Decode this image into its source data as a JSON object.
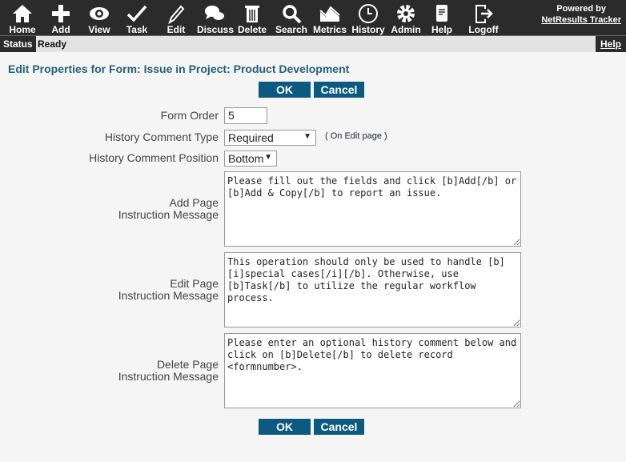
{
  "toolbar": {
    "items": [
      {
        "label": "Home",
        "icon": "home-icon"
      },
      {
        "label": "Add",
        "icon": "plus-icon"
      },
      {
        "label": "View",
        "icon": "eye-icon"
      },
      {
        "label": "Task",
        "icon": "check-icon"
      },
      {
        "label": "Edit",
        "icon": "pencil-icon"
      },
      {
        "label": "Discuss",
        "icon": "chat-icon"
      },
      {
        "label": "Delete",
        "icon": "trash-icon"
      },
      {
        "label": "Search",
        "icon": "search-icon"
      },
      {
        "label": "Metrics",
        "icon": "chart-icon"
      },
      {
        "label": "History",
        "icon": "clock-icon"
      },
      {
        "label": "Admin",
        "icon": "gear-icon"
      },
      {
        "label": "Help",
        "icon": "document-icon"
      },
      {
        "label": "Logoff",
        "icon": "logout-icon"
      }
    ],
    "powered_by": "Powered by",
    "brand_link": "NetResults Tracker"
  },
  "status": {
    "label": "Status",
    "value": "Ready",
    "help": "Help"
  },
  "page": {
    "title": "Edit Properties for Form: Issue in Project: Product Development",
    "ok": "OK",
    "cancel": "Cancel"
  },
  "form": {
    "form_order_label": "Form Order",
    "form_order": "5",
    "history_type_label": "History Comment Type",
    "history_type": "Required",
    "history_type_note": "( On Edit page )",
    "history_pos_label": "History Comment Position",
    "history_pos": "Bottom",
    "add_label1": "Add Page",
    "add_label2": "Instruction Message",
    "add_msg": "Please fill out the fields and click [b]Add[/b] or [b]Add & Copy[/b] to report an issue.",
    "edit_label1": "Edit Page",
    "edit_label2": "Instruction Message",
    "edit_msg": "This operation should only be used to handle [b][i]special cases[/i][/b]. Otherwise, use [b]Task[/b] to utilize the regular workflow process.",
    "delete_label1": "Delete Page",
    "delete_label2": "Instruction Message",
    "delete_msg": "Please enter an optional history comment below and click on [b]Delete[/b] to delete record <formnumber>."
  },
  "colors": {
    "toolbar": "#2b2b2b",
    "accent": "#0d5a80",
    "title": "#22607a"
  }
}
